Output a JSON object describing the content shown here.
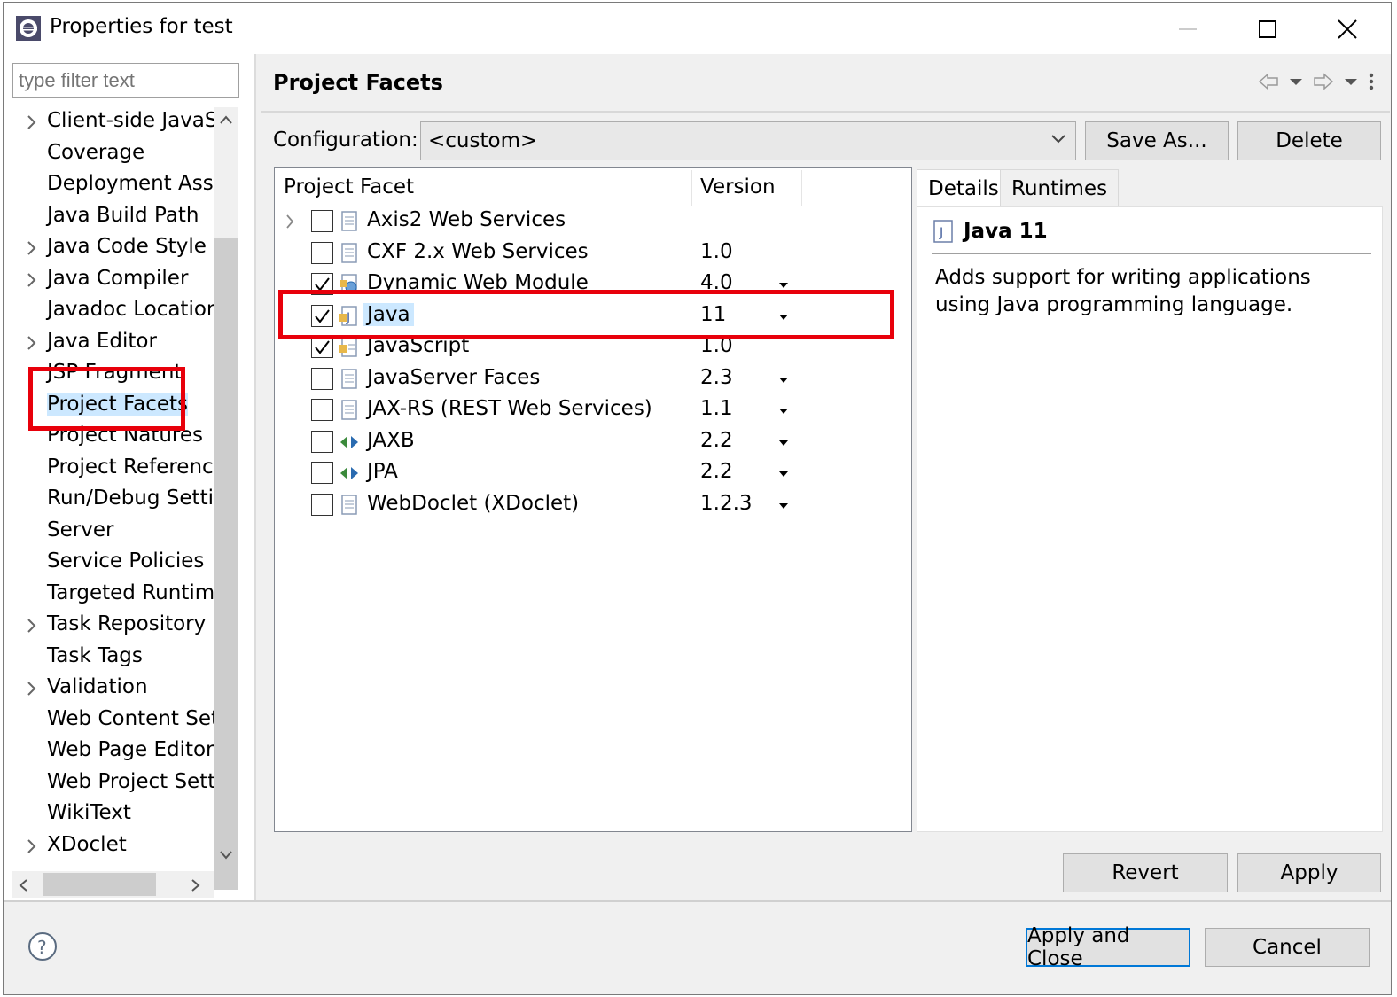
{
  "window": {
    "title": "Properties for test",
    "minimize_icon": "minimize-icon",
    "maximize_icon": "maximize-icon",
    "close_icon": "close-icon"
  },
  "filter": {
    "placeholder": "type filter text"
  },
  "tree": {
    "items": [
      {
        "label": "Client-side JavaSc",
        "expandable": true
      },
      {
        "label": "Coverage",
        "expandable": false
      },
      {
        "label": "Deployment Asser",
        "expandable": false
      },
      {
        "label": "Java Build Path",
        "expandable": false
      },
      {
        "label": "Java Code Style",
        "expandable": true
      },
      {
        "label": "Java Compiler",
        "expandable": true
      },
      {
        "label": "Javadoc Location",
        "expandable": false
      },
      {
        "label": "Java Editor",
        "expandable": true
      },
      {
        "label": "JSP Fragment",
        "expandable": false
      },
      {
        "label": "Project Facets",
        "expandable": false,
        "selected": true
      },
      {
        "label": "Project Natures",
        "expandable": false
      },
      {
        "label": "Project Reference",
        "expandable": false
      },
      {
        "label": "Run/Debug Settir",
        "expandable": false
      },
      {
        "label": "Server",
        "expandable": false
      },
      {
        "label": "Service Policies",
        "expandable": false
      },
      {
        "label": "Targeted Runtime",
        "expandable": false
      },
      {
        "label": "Task Repository",
        "expandable": true
      },
      {
        "label": "Task Tags",
        "expandable": false
      },
      {
        "label": "Validation",
        "expandable": true
      },
      {
        "label": "Web Content Sett",
        "expandable": false
      },
      {
        "label": "Web Page Editor",
        "expandable": false
      },
      {
        "label": "Web Project Settii",
        "expandable": false
      },
      {
        "label": "WikiText",
        "expandable": false
      },
      {
        "label": "XDoclet",
        "expandable": true
      }
    ]
  },
  "page": {
    "title": "Project Facets",
    "config_label": "Configuration:",
    "config_value": "<custom>",
    "save_as": "Save As...",
    "delete": "Delete"
  },
  "facets": {
    "col_facet": "Project Facet",
    "col_version": "Version",
    "rows": [
      {
        "name": "Axis2 Web Services",
        "version": "",
        "checked": false,
        "dropdown": false,
        "expandable": true,
        "icon": "doc-icon"
      },
      {
        "name": "CXF 2.x Web Services",
        "version": "1.0",
        "checked": false,
        "dropdown": false,
        "icon": "doc-icon"
      },
      {
        "name": "Dynamic Web Module",
        "version": "4.0",
        "checked": true,
        "dropdown": true,
        "icon": "web-module-icon"
      },
      {
        "name": "Java",
        "version": "11",
        "checked": true,
        "dropdown": true,
        "selected": true,
        "icon": "java-icon"
      },
      {
        "name": "JavaScript",
        "version": "1.0",
        "checked": true,
        "dropdown": false,
        "icon": "javascript-icon"
      },
      {
        "name": "JavaServer Faces",
        "version": "2.3",
        "checked": false,
        "dropdown": true,
        "icon": "doc-icon"
      },
      {
        "name": "JAX-RS (REST Web Services)",
        "version": "1.1",
        "checked": false,
        "dropdown": true,
        "icon": "doc-icon"
      },
      {
        "name": "JAXB",
        "version": "2.2",
        "checked": false,
        "dropdown": true,
        "icon": "arrows-icon"
      },
      {
        "name": "JPA",
        "version": "2.2",
        "checked": false,
        "dropdown": true,
        "icon": "arrows-icon"
      },
      {
        "name": "WebDoclet (XDoclet)",
        "version": "1.2.3",
        "checked": false,
        "dropdown": true,
        "icon": "doc-icon"
      }
    ]
  },
  "details": {
    "tab_details": "Details",
    "tab_runtimes": "Runtimes",
    "title": "Java 11",
    "description": "Adds support for writing applications using Java programming language."
  },
  "buttons": {
    "revert": "Revert",
    "apply": "Apply",
    "apply_close": "Apply and Close",
    "cancel": "Cancel"
  },
  "colors": {
    "highlight": "#e8000b",
    "selection": "#cce8ff"
  }
}
